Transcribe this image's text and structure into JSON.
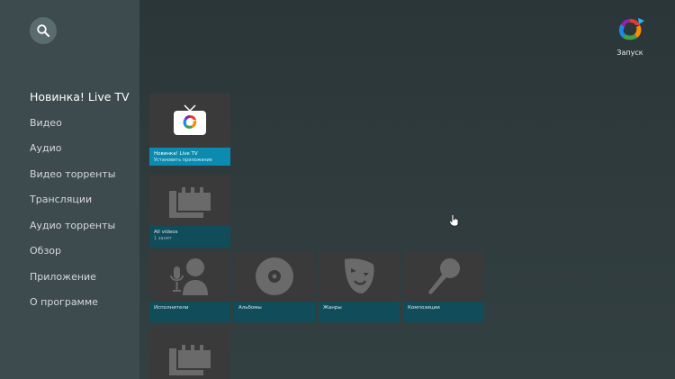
{
  "sidebar": {
    "items": [
      {
        "label": "Новинка! Live TV",
        "active": true
      },
      {
        "label": "Видео"
      },
      {
        "label": "Аудио"
      },
      {
        "label": "Видео торренты"
      },
      {
        "label": "Трансляции"
      },
      {
        "label": "Аудио торренты"
      },
      {
        "label": "Обзор"
      },
      {
        "label": "Приложение"
      },
      {
        "label": "О программе"
      }
    ]
  },
  "header": {
    "launch_label": "Запуск"
  },
  "cards": {
    "livetv": {
      "title": "Новинка! Live TV",
      "subtitle": "Установить приложение"
    },
    "allvideos": {
      "title": "All videos",
      "subtitle": "1 занят"
    },
    "artists": {
      "title": "Исполнители"
    },
    "albums": {
      "title": "Альбомы"
    },
    "genres": {
      "title": "Жанры"
    },
    "compositions": {
      "title": "Композиции"
    }
  },
  "colors": {
    "sidebar": "#3d4a4e",
    "background": "#2f3b3d",
    "accent": "#0b8bb0",
    "card_thumb": "#3a3a3a",
    "card_info": "#114c5b"
  }
}
